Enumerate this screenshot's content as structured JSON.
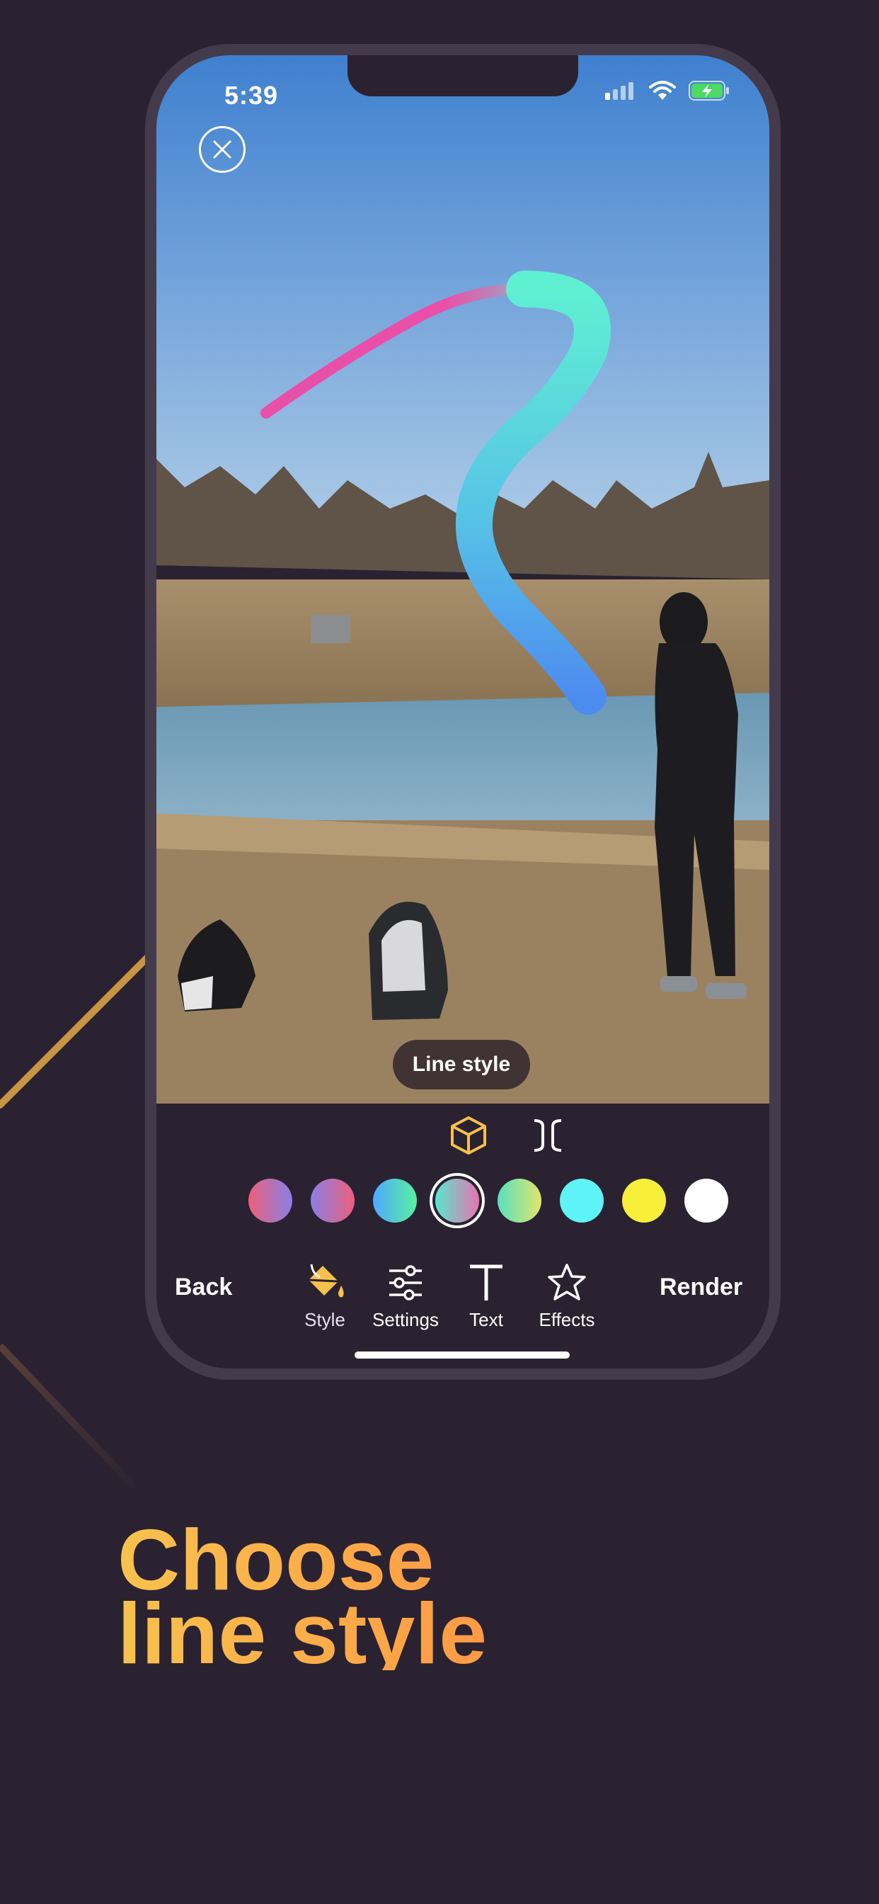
{
  "status_bar": {
    "time": "5:39"
  },
  "editor": {
    "tooltip": "Line style"
  },
  "colors": {
    "accent": "#f6c14a",
    "background": "#2a2231",
    "swatches": [
      {
        "from": "#ec5f7a",
        "to": "#8a7fe6"
      },
      {
        "from": "#8a7fe6",
        "to": "#ec5f7a"
      },
      {
        "from": "#4fa8ff",
        "to": "#5af0a0"
      },
      {
        "from": "#58e6cf",
        "to": "#e873b0",
        "selected": true
      },
      {
        "from": "#58e0c0",
        "to": "#e4e46a"
      },
      {
        "from": "#5ef3f7",
        "to": "#5ef3f7"
      },
      {
        "from": "#f7ef39",
        "to": "#f7ef39"
      },
      {
        "from": "#ffffff",
        "to": "#ffffff"
      }
    ]
  },
  "toolbar": {
    "back_label": "Back",
    "render_label": "Render",
    "tools": [
      {
        "label": "Style",
        "icon": "paint-bucket-icon",
        "active": true
      },
      {
        "label": "Settings",
        "icon": "sliders-icon"
      },
      {
        "label": "Text",
        "icon": "text-icon"
      },
      {
        "label": "Effects",
        "icon": "star-icon"
      }
    ]
  },
  "promo": {
    "headline_line1": "Choose",
    "headline_line2": "line style"
  }
}
